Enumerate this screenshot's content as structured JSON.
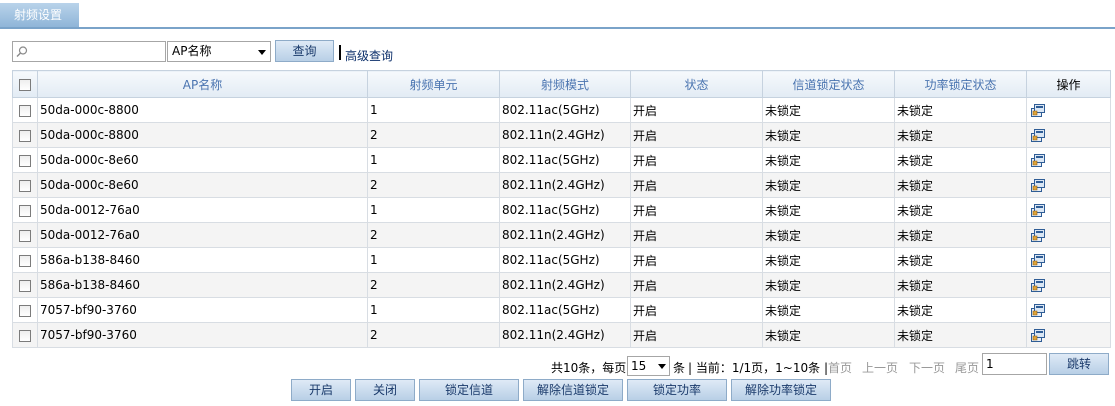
{
  "tab": {
    "label": "射频设置"
  },
  "search": {
    "value": "",
    "placeholder": "",
    "field_selected": "AP名称",
    "query_label": "查询",
    "advanced_label": "高级查询"
  },
  "table": {
    "headers": {
      "ap_name": "AP名称",
      "radio_unit": "射频单元",
      "radio_mode": "射频模式",
      "status": "状态",
      "channel_lock": "信道锁定状态",
      "power_lock": "功率锁定状态",
      "action": "操作"
    },
    "rows": [
      {
        "ap_name": "50da-000c-8800",
        "radio_unit": "1",
        "radio_mode": "802.11ac(5GHz)",
        "status": "开启",
        "channel_lock": "未锁定",
        "power_lock": "未锁定"
      },
      {
        "ap_name": "50da-000c-8800",
        "radio_unit": "2",
        "radio_mode": "802.11n(2.4GHz)",
        "status": "开启",
        "channel_lock": "未锁定",
        "power_lock": "未锁定"
      },
      {
        "ap_name": "50da-000c-8e60",
        "radio_unit": "1",
        "radio_mode": "802.11ac(5GHz)",
        "status": "开启",
        "channel_lock": "未锁定",
        "power_lock": "未锁定"
      },
      {
        "ap_name": "50da-000c-8e60",
        "radio_unit": "2",
        "radio_mode": "802.11n(2.4GHz)",
        "status": "开启",
        "channel_lock": "未锁定",
        "power_lock": "未锁定"
      },
      {
        "ap_name": "50da-0012-76a0",
        "radio_unit": "1",
        "radio_mode": "802.11ac(5GHz)",
        "status": "开启",
        "channel_lock": "未锁定",
        "power_lock": "未锁定"
      },
      {
        "ap_name": "50da-0012-76a0",
        "radio_unit": "2",
        "radio_mode": "802.11n(2.4GHz)",
        "status": "开启",
        "channel_lock": "未锁定",
        "power_lock": "未锁定"
      },
      {
        "ap_name": "586a-b138-8460",
        "radio_unit": "1",
        "radio_mode": "802.11ac(5GHz)",
        "status": "开启",
        "channel_lock": "未锁定",
        "power_lock": "未锁定"
      },
      {
        "ap_name": "586a-b138-8460",
        "radio_unit": "2",
        "radio_mode": "802.11n(2.4GHz)",
        "status": "开启",
        "channel_lock": "未锁定",
        "power_lock": "未锁定"
      },
      {
        "ap_name": "7057-bf90-3760",
        "radio_unit": "1",
        "radio_mode": "802.11ac(5GHz)",
        "status": "开启",
        "channel_lock": "未锁定",
        "power_lock": "未锁定"
      },
      {
        "ap_name": "7057-bf90-3760",
        "radio_unit": "2",
        "radio_mode": "802.11n(2.4GHz)",
        "status": "开启",
        "channel_lock": "未锁定",
        "power_lock": "未锁定"
      }
    ]
  },
  "pager": {
    "total_prefix": "共10条，每页",
    "per_page": "15",
    "total_suffix": "条",
    "current": "| 当前：1/1页，1~10条 |",
    "first": "首页",
    "prev": "上一页",
    "next": "下一页",
    "last": "尾页",
    "page_value": "1",
    "jump_label": "跳转"
  },
  "actions": {
    "enable": "开启",
    "disable": "关闭",
    "lock_channel": "锁定信道",
    "unlock_channel": "解除信道锁定",
    "lock_power": "锁定功率",
    "unlock_power": "解除功率锁定"
  },
  "icons": {
    "search": "magnifier-icon",
    "row_action": "edit-config-icon"
  },
  "colors": {
    "tab_bg": "#a8c7e4",
    "header_text": "#4a74b0",
    "button_bg": "#c9dbee",
    "button_border": "#8eabc8"
  }
}
